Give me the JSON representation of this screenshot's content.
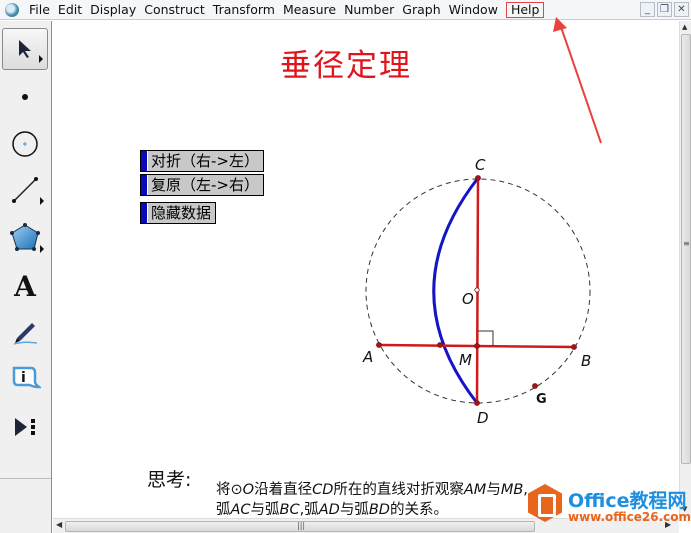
{
  "menubar": {
    "items": [
      "File",
      "Edit",
      "Display",
      "Construct",
      "Transform",
      "Measure",
      "Number",
      "Graph",
      "Window",
      "Help"
    ],
    "highlighted": "Help",
    "window_buttons": [
      "minimize",
      "restore",
      "close"
    ]
  },
  "toolbox": {
    "tools": [
      {
        "name": "arrow-tool",
        "icon": "arrow-icon",
        "selected": true
      },
      {
        "name": "point-tool",
        "icon": "point-icon"
      },
      {
        "name": "compass-tool",
        "icon": "circle-icon"
      },
      {
        "name": "straightedge-tool",
        "icon": "segment-icon"
      },
      {
        "name": "polygon-tool",
        "icon": "pentagon-icon"
      },
      {
        "name": "text-tool",
        "icon": "text-A-icon",
        "glyph": "A"
      },
      {
        "name": "marker-tool",
        "icon": "pen-icon"
      },
      {
        "name": "information-tool",
        "icon": "info-icon",
        "glyph": "i"
      },
      {
        "name": "custom-tool",
        "icon": "play-custom-icon"
      }
    ]
  },
  "document": {
    "title": "垂径定理",
    "title_color": "#e0141b",
    "buttons": [
      {
        "label": "对折（右->左）"
      },
      {
        "label": "复原（左->右）"
      },
      {
        "label": "隐藏数据"
      }
    ],
    "figure": {
      "points": {
        "C": "C",
        "D": "D",
        "O": "O",
        "A": "A",
        "B": "B",
        "M": "M",
        "G": "G"
      },
      "segment_color": "#d01a1a",
      "arc_color": "#1515c8",
      "circle_style": "dashed"
    },
    "think": {
      "label": "思考:",
      "line1": [
        {
          "t": "将⊙",
          "i": false
        },
        {
          "t": "O",
          "i": true
        },
        {
          "t": "沿着直径",
          "i": false
        },
        {
          "t": "CD",
          "i": true
        },
        {
          "t": "所在的直线对折观察",
          "i": false
        },
        {
          "t": "AM",
          "i": true
        },
        {
          "t": "与",
          "i": false
        },
        {
          "t": "MB",
          "i": true
        },
        {
          "t": ",",
          "i": false
        }
      ],
      "line2": [
        {
          "t": "弧",
          "i": false
        },
        {
          "t": "AC",
          "i": true
        },
        {
          "t": "与弧",
          "i": false
        },
        {
          "t": "BC",
          "i": true
        },
        {
          "t": ",弧",
          "i": false
        },
        {
          "t": "AD",
          "i": true
        },
        {
          "t": "与弧",
          "i": false
        },
        {
          "t": "BD",
          "i": true
        },
        {
          "t": "的关系。",
          "i": false
        }
      ]
    }
  },
  "watermark": {
    "title": "Office教程网",
    "url": "www.office26.com"
  },
  "annotation": {
    "arrow_color": "#e8433f",
    "points_to": "Help"
  }
}
